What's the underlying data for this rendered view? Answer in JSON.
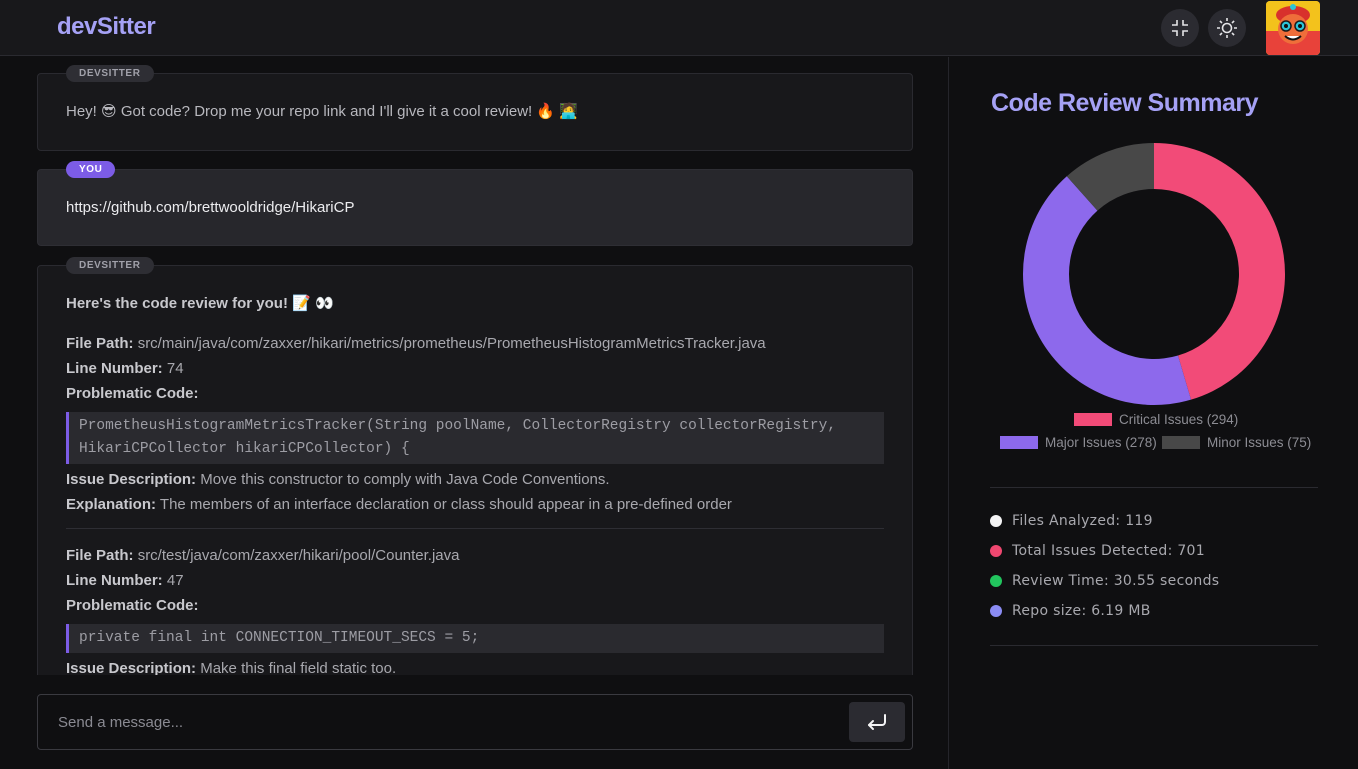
{
  "header": {
    "brand": "devSitter"
  },
  "messages": [
    {
      "role_label": "DEVSITTER",
      "text": "Hey! 😎 Got code? Drop me your repo link and I'll give it a cool review! 🔥 🧑‍💻"
    },
    {
      "role_label": "YOU",
      "text": "https://github.com/brettwooldridge/HikariCP"
    },
    {
      "role_label": "DEVSITTER",
      "title": "Here's the code review for you! 📝 👀",
      "issues": [
        {
          "file_path_label": "File Path:",
          "file_path": "src/main/java/com/zaxxer/hikari/metrics/prometheus/PrometheusHistogramMetricsTracker.java",
          "line_label": "Line Number:",
          "line": "74",
          "code_label": "Problematic Code:",
          "code_lines": [
            "PrometheusHistogramMetricsTracker(String poolName, CollectorRegistry collectorRegistry,",
            "HikariCPCollector hikariCPCollector) {"
          ],
          "desc_label": "Issue Description:",
          "desc": "Move this constructor to comply with Java Code Conventions.",
          "expl_label": "Explanation:",
          "expl": "The members of an interface declaration or class should appear in a pre-defined order"
        },
        {
          "file_path_label": "File Path:",
          "file_path": "src/test/java/com/zaxxer/hikari/pool/Counter.java",
          "line_label": "Line Number:",
          "line": "47",
          "code_label": "Problematic Code:",
          "code_lines": [
            "private final int CONNECTION_TIMEOUT_SECS = 5;"
          ],
          "desc_label": "Issue Description:",
          "desc": "Make this final field static too."
        }
      ]
    }
  ],
  "input": {
    "placeholder": "Send a message..."
  },
  "summary": {
    "title": "Code Review Summary",
    "stats": [
      {
        "text": "Files Analyzed: 119",
        "color": "#f4f4f5"
      },
      {
        "text": "Total Issues Detected: 701",
        "color": "#ef4770"
      },
      {
        "text": "Review Time: 30.55 seconds",
        "color": "#22c55e"
      },
      {
        "text": "Repo size: 6.19 MB",
        "color": "#8b8cf4"
      }
    ]
  },
  "chart_data": {
    "type": "pie",
    "variant": "donut",
    "legend_position": "bottom",
    "series": [
      {
        "name": "Critical Issues (294)",
        "value": 294,
        "color": "#f24b78"
      },
      {
        "name": "Major Issues (278)",
        "value": 278,
        "color": "#8d69ec"
      },
      {
        "name": "Minor Issues (75)",
        "value": 75,
        "color": "#484848"
      }
    ]
  },
  "colors": {
    "accent": "#a5a1f5",
    "you_badge": "#7c5ce6"
  }
}
